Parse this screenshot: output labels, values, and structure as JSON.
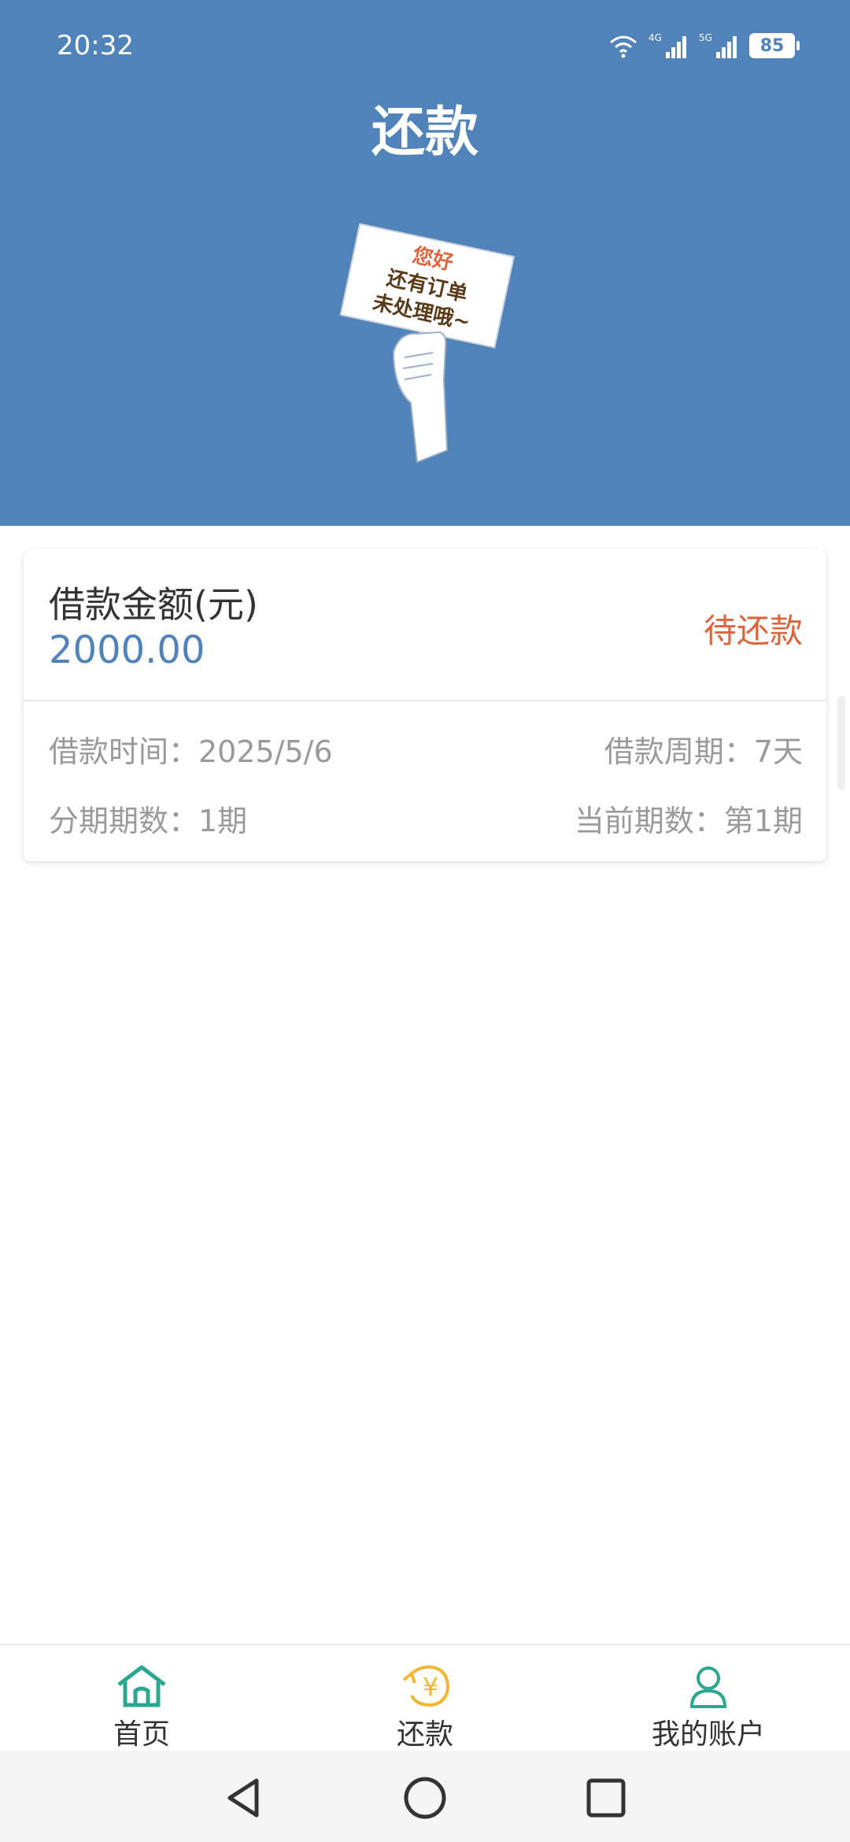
{
  "status_bar": {
    "time": "20:32",
    "battery": "85",
    "network_1": "4G",
    "network_2": "5G"
  },
  "header": {
    "title": "还款",
    "sign_line1": "您好",
    "sign_line2": "还有订单",
    "sign_line3": "未处理哦~"
  },
  "loan_card": {
    "amount_label": "借款金额(元)",
    "amount_value": "2000.00",
    "status": "待还款",
    "loan_time": "借款时间：2025/5/6",
    "loan_period": "借款周期：7天",
    "installments": "分期期数：1期",
    "current_period": "当前期数：第1期"
  },
  "tabbar": {
    "items": [
      {
        "label": "首页",
        "icon": "home-icon",
        "color": "#2aa88f"
      },
      {
        "label": "还款",
        "icon": "repay-yuan-icon",
        "color": "#f2b631"
      },
      {
        "label": "我的账户",
        "icon": "user-icon",
        "color": "#2aa88f"
      }
    ]
  },
  "colors": {
    "header_bg": "#4f83b9",
    "amount": "#4f83b9",
    "status": "#e0643b",
    "secondary_text": "#9a9a9a"
  }
}
